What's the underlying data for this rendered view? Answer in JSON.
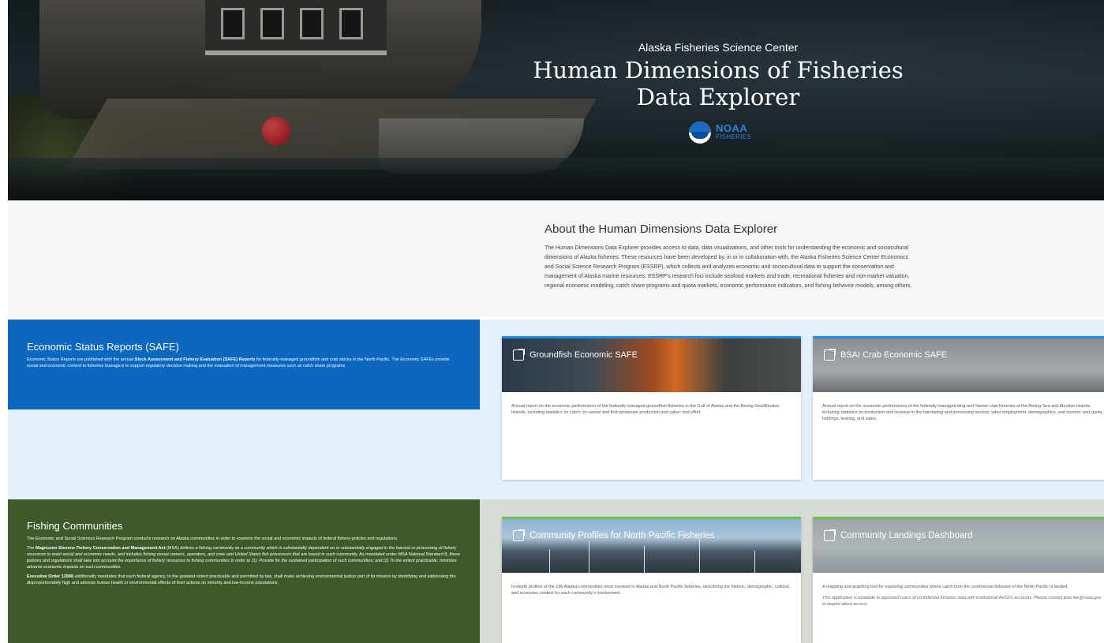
{
  "hero": {
    "kicker": "Alaska Fisheries Science Center",
    "title_line1": "Human Dimensions of Fisheries",
    "title_line2": "Data Explorer",
    "logo_top": "NOAA",
    "logo_bottom": "FISHERIES"
  },
  "about": {
    "title": "About the Human Dimensions Data Explorer",
    "body": "The Human Dimensions Data Explorer provides access to data, data visualizations, and other tools for understanding the economic and sociocultural dimensions of Alaska fisheries. These resources have been developed by, in or in collaboration with, the Alaska Fisheries Science Center Economics and Social Science Research Program (ESSRP), which collects and analyzes economic and sociocultural data to support the conservation and management of Alaska marine resources. ESSRP's research foci include seafood markets and trade, recreational fisheries and non-market valuation, regional economic modeling, catch share programs and quota markets, economic performance indicators, and fishing behavior models, among others."
  },
  "economic": {
    "title": "Economic Status Reports (SAFE)",
    "desc_pre": "Economic Status Reports are published with the annual ",
    "desc_bold": "Stock Assessment and Fishery Evaluation (SAFE) Reports",
    "desc_post": " for federally-managed groundfish and crab stocks in the North Pacific. The Economic SAFEs provide social and economic context to fisheries managers to support regulatory decision making and the evaluation of management measures such as catch share programs",
    "cards": [
      {
        "title": "Groundfish Economic SAFE",
        "body": "Annual report on the economic performance of the federally-managed groundfish fisheries in the Gulf of Alaska and the Bering Sea/Aleutian Islands, including statistics on catch; ex-vessel and first-wholesale production and value; and effort."
      },
      {
        "title": "BSAI Crab Economic SAFE",
        "body": "Annual report on the economic performance of the federally-managed king and Tanner crab fisheries of the Bering Sea and Aleutian Islands, including statistics on production and revenue in the harvesting and processing sectors; labor employment, demographics, and income; and quota holdings, leasing, and sales."
      }
    ]
  },
  "communities": {
    "title": "Fishing Communities",
    "p1": "The Economic and Social Sciences Research Program conducts research on Alaska communities in order to examine the social and economic impacts of federal fishery policies and regulations.",
    "p2_pre": "The ",
    "p2_bold": "Magnuson Stevens Fishery Conservation and Management Act",
    "p2_mid": " (MSA) defines a fishing community as ",
    "p2_ital": "a community which is substantially dependent on or substantially engaged in the harvest or processing of fishery resources to meet social and economic needs, and includes fishing vessel owners, operators, and crew and United States fish processors that are based in such community.",
    "p2_mid2": " As mandated under MSA National Standard 8, ",
    "p2_ital2": "these policies and regulations shall take into account the importance of fishery resources to fishing communities in order to (1): Provide for the sustained participation of such communities; and (2) To the extent practicable, minimize adverse economic impacts on such communities.",
    "p3_bold": "Executive Order 12898",
    "p3_post": " additionally mandates that each federal agency, to the greatest extent practicable and permitted by law, shall make achieving environmental justice part of its mission by identifying and addressing the disproportionately high and adverse human health or environmental effects of their actions on minority and low-income populations.",
    "cards": [
      {
        "title": "Community Profiles for North Pacific Fisheries",
        "body": "In-depth profiles of the 196 Alaska communities most involved in Alaska and North Pacific fisheries, describing the historic, demographic, cultural, and economic context for each community's involvement."
      },
      {
        "title": "Community Landings Dashboard",
        "body": "A mapping and graphing tool for exploring communities where catch from the commercial fisheries of the North Pacific is landed.",
        "note": "This application is available to approved users of confidential fisheries data with institutional ArcGIS accounts. Please contact jean.lee@noaa.gov to inquire about access."
      }
    ]
  },
  "colors": {
    "economic_panel": "#0b67c0",
    "economic_bg": "#e2f0fb",
    "community_panel": "#3e5a2b",
    "community_bg": "#d6dbd3",
    "econ_card_border": "#1d8ee8",
    "comm_card_border": "#6bbf4a"
  }
}
